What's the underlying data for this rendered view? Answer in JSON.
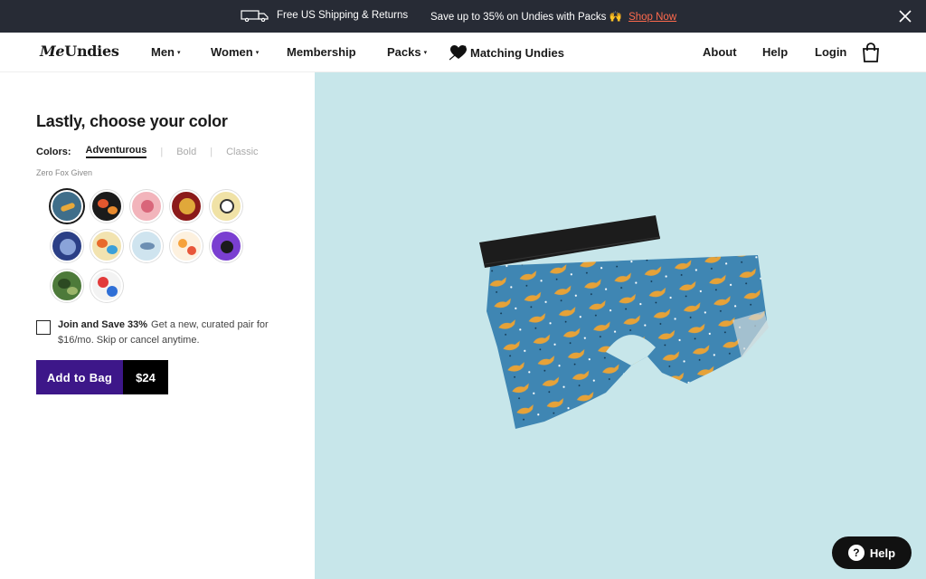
{
  "promo": {
    "shipping": "Free US Shipping & Returns",
    "save": "Save up to 35% on Undies with Packs 🙌",
    "shop_now": "Shop Now"
  },
  "nav": {
    "logo_me": "Me",
    "logo_undies": "Undies",
    "items": [
      "Men",
      "Women",
      "Membership",
      "Packs",
      "Matching Undies",
      "About",
      "Help",
      "Login"
    ]
  },
  "left": {
    "heading": "Lastly, choose your color",
    "colors_label": "Colors:",
    "tabs": [
      "Adventurous",
      "Bold",
      "Classic"
    ],
    "selected_color": "Zero Fox Given"
  },
  "join": {
    "title": "Join and Save 33%",
    "text": "Get a new, curated pair for $16/mo. Skip or cancel anytime."
  },
  "cta": {
    "label": "Add to Bag",
    "price": "$24"
  },
  "help_widget": {
    "label": "Help",
    "icon": "?"
  },
  "colors": {
    "brand_purple": "#3d1789",
    "hero_bg": "#c7e6ea",
    "promo_bg": "#272b35",
    "shop_link": "#ff6a4d"
  },
  "swatch_colors": [
    "#3f6e8a",
    "#1b1b1b",
    "#f2b4bb",
    "#8b1a1a",
    "#f0e2a6",
    "#2b3f86",
    "#e86a2a",
    "#cfe4ef",
    "#f6c04e",
    "#7a3fd1",
    "#4d7a3a",
    "#f3f3f3"
  ]
}
